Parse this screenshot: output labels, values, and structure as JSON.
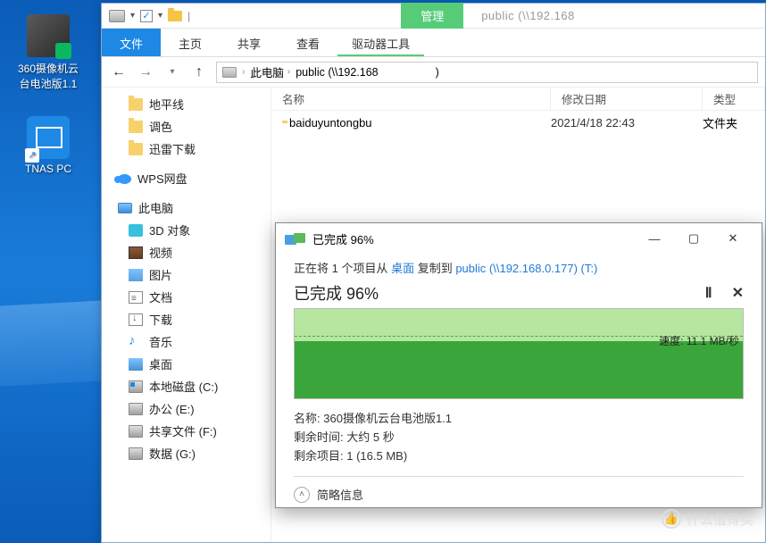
{
  "desktop_icons": [
    {
      "label": "360摄像机云台电池版1.1"
    },
    {
      "label": "TNAS PC"
    }
  ],
  "window": {
    "manage_tab": "管理",
    "title": "public (\\\\192.168",
    "ribbon": {
      "file": "文件",
      "home": "主页",
      "share": "共享",
      "view": "查看",
      "drivetools": "驱动器工具"
    },
    "breadcrumbs": {
      "root": "此电脑",
      "loc": "public (\\\\192.168"
    }
  },
  "sidebar": {
    "items": [
      {
        "label": "地平线",
        "icon": "folder",
        "level": 1
      },
      {
        "label": "调色",
        "icon": "folder",
        "level": 1
      },
      {
        "label": "迅雷下载",
        "icon": "folder",
        "level": 1
      },
      {
        "label": "WPS网盘",
        "icon": "cloud",
        "level": 0
      },
      {
        "label": "此电脑",
        "icon": "pc",
        "level": 0
      },
      {
        "label": "3D 对象",
        "icon": "threed",
        "level": 1
      },
      {
        "label": "视频",
        "icon": "video",
        "level": 1
      },
      {
        "label": "图片",
        "icon": "image",
        "level": 1
      },
      {
        "label": "文档",
        "icon": "doc",
        "level": 1
      },
      {
        "label": "下载",
        "icon": "download",
        "level": 1
      },
      {
        "label": "音乐",
        "icon": "music",
        "level": 1
      },
      {
        "label": "桌面",
        "icon": "desktop-i",
        "level": 1
      },
      {
        "label": "本地磁盘 (C:)",
        "icon": "drive c",
        "level": 1
      },
      {
        "label": "办公 (E:)",
        "icon": "drive",
        "level": 1
      },
      {
        "label": "共享文件 (F:)",
        "icon": "drive",
        "level": 1
      },
      {
        "label": "数据 (G:)",
        "icon": "drive",
        "level": 1
      }
    ]
  },
  "columns": {
    "name": "名称",
    "date": "修改日期",
    "type": "类型"
  },
  "rows": [
    {
      "name": "baiduyuntongbu",
      "date": "2021/4/18 22:43",
      "type": "文件夹"
    }
  ],
  "copy_dialog": {
    "title_prefix": "已完成",
    "title_percent": "96%",
    "line1_a": "正在将 1 个项目从 ",
    "line1_src": "桌面",
    "line1_b": " 复制到 ",
    "line1_dst": "public (\\\\192.168.0.177) (T:)",
    "done_label": "已完成",
    "done_percent": "96%",
    "speed_label": "速度:",
    "speed_value": "11.1 MB/秒",
    "detail_name_label": "名称:",
    "detail_name_value": "360摄像机云台电池版1.1",
    "detail_time_label": "剩余时间:",
    "detail_time_value": "大约 5 秒",
    "detail_items_label": "剩余项目:",
    "detail_items_value": "1 (16.5 MB)",
    "brief_info": "简略信息"
  },
  "watermark": "什么值得买"
}
